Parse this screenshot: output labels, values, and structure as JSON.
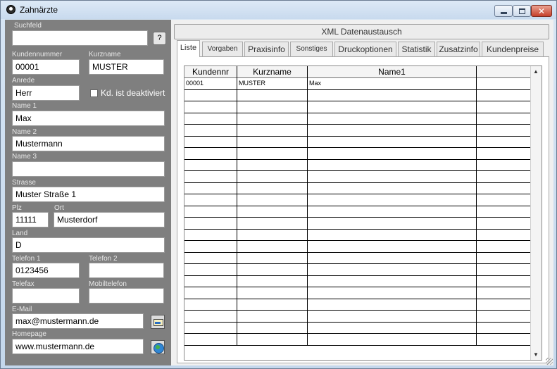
{
  "window": {
    "title": "Zahnärzte",
    "icon": "app-icon",
    "controls": {
      "minimize": "minimize-icon",
      "maximize": "maximize-icon",
      "close": "✕"
    }
  },
  "left": {
    "suchfeld": {
      "label": "Suchfeld",
      "value": "",
      "button": "?"
    },
    "kundennummer": {
      "label": "Kundennummer",
      "value": "00001"
    },
    "kurzname": {
      "label": "Kurzname",
      "value": "MUSTER"
    },
    "anrede": {
      "label": "Anrede",
      "value": "Herr"
    },
    "deaktiviert": {
      "label": "Kd. ist deaktiviert",
      "checked": false
    },
    "name1": {
      "label": "Name 1",
      "value": "Max"
    },
    "name2": {
      "label": "Name 2",
      "value": "Mustermann"
    },
    "name3": {
      "label": "Name 3",
      "value": ""
    },
    "strasse": {
      "label": "Strasse",
      "value": "Muster Straße 1"
    },
    "plz": {
      "label": "Plz",
      "value": "11111"
    },
    "ort": {
      "label": "Ort",
      "value": "Musterdorf"
    },
    "land": {
      "label": "Land",
      "value": "D"
    },
    "telefon1": {
      "label": "Telefon 1",
      "value": "0123456"
    },
    "telefon2": {
      "label": "Telefon 2",
      "value": ""
    },
    "telefax": {
      "label": "Telefax",
      "value": ""
    },
    "mobiltelefon": {
      "label": "Mobiltelefon",
      "value": ""
    },
    "email": {
      "label": "E-Mail",
      "value": "max@mustermann.de",
      "button_icon": "mail-icon"
    },
    "homepage": {
      "label": "Homepage",
      "value": "www.mustermann.de",
      "button_icon": "globe-icon"
    }
  },
  "right": {
    "xml_button": "XML Datenaustausch",
    "tabs": [
      {
        "label": "Liste",
        "active": true
      },
      {
        "label": "Vorgaben"
      },
      {
        "label": "Praxisinfo"
      },
      {
        "label": "Sonstiges"
      },
      {
        "label": "Druckoptionen"
      },
      {
        "label": "Statistik"
      },
      {
        "label": "Zusatzinfo"
      },
      {
        "label": "Kundenpreise"
      }
    ],
    "grid": {
      "columns": [
        "Kundennr",
        "Kurzname",
        "Name1",
        ""
      ],
      "rows": [
        [
          "00001",
          "MUSTER",
          "Max",
          ""
        ]
      ],
      "empty_rows": 22
    }
  }
}
